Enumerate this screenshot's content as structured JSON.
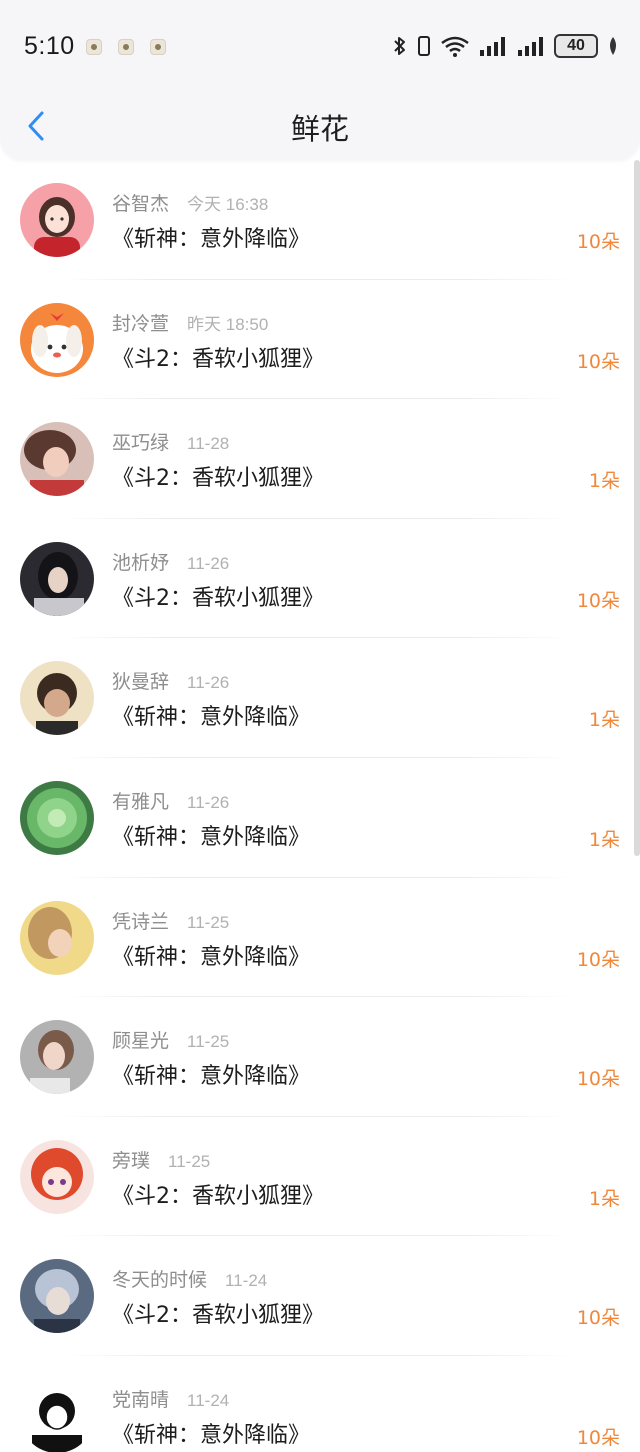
{
  "status_bar": {
    "time": "5:10",
    "battery": "40",
    "notification_icons": [
      "app-notification-icon",
      "app-notification-icon",
      "app-notification-icon"
    ]
  },
  "header": {
    "title": "鲜花",
    "accent_color": "#2f8ef0"
  },
  "colors": {
    "count": "#f0883c",
    "name": "#8e8e8e",
    "date": "#b1b1b1"
  },
  "rows": [
    {
      "name": "谷智杰",
      "date": "今天 16:38",
      "book": "《斩神：意外降临》",
      "count": "10朵"
    },
    {
      "name": "封冷萱",
      "date": "昨天 18:50",
      "book": "《斗2：香软小狐狸》",
      "count": "10朵"
    },
    {
      "name": "巫巧绿",
      "date": "11-28",
      "book": "《斗2：香软小狐狸》",
      "count": "1朵"
    },
    {
      "name": "池析妤",
      "date": "11-26",
      "book": "《斗2：香软小狐狸》",
      "count": "10朵"
    },
    {
      "name": "狄曼辞",
      "date": "11-26",
      "book": "《斩神：意外降临》",
      "count": "1朵"
    },
    {
      "name": "有雅凡",
      "date": "11-26",
      "book": "《斩神：意外降临》",
      "count": "1朵"
    },
    {
      "name": "凭诗兰",
      "date": "11-25",
      "book": "《斩神：意外降临》",
      "count": "10朵"
    },
    {
      "name": "顾星光",
      "date": "11-25",
      "book": "《斩神：意外降临》",
      "count": "10朵"
    },
    {
      "name": "旁璞",
      "date": "11-25",
      "book": "《斗2：香软小狐狸》",
      "count": "1朵"
    },
    {
      "name": "冬天的时候",
      "date": "11-24",
      "book": "《斗2：香软小狐狸》",
      "count": "10朵"
    },
    {
      "name": "党南晴",
      "date": "11-24",
      "book": "《斩神：意外降临》",
      "count": "10朵"
    }
  ]
}
